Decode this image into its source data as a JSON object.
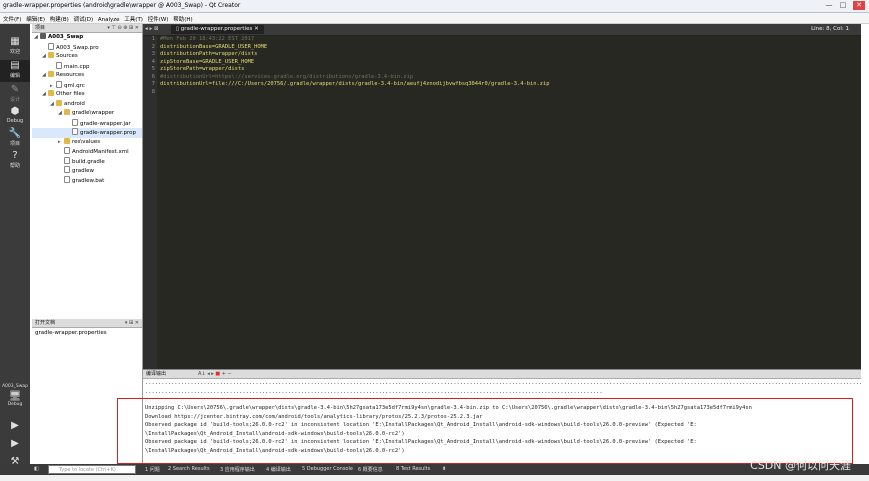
{
  "window": {
    "title": "gradle-wrapper.properties (android\\gradle\\wrapper @ A003_Swap) - Qt Creator",
    "controls": [
      "—",
      "□",
      "✕"
    ]
  },
  "menu": [
    "文件(F)",
    "编辑(E)",
    "构建(B)",
    "调试(D)",
    "Analyze",
    "工具(T)",
    "控件(W)",
    "帮助(H)"
  ],
  "modes": [
    {
      "icon": "grid-icon",
      "glyph": "▦",
      "label": "欢迎"
    },
    {
      "icon": "edit-icon",
      "glyph": "▤",
      "label": "编辑"
    },
    {
      "icon": "design-icon",
      "glyph": "✎",
      "label": "设计"
    },
    {
      "icon": "debug-icon",
      "glyph": "⬢",
      "label": "Debug"
    },
    {
      "icon": "projects-icon",
      "glyph": "🔧",
      "label": "项目"
    },
    {
      "icon": "help-icon",
      "glyph": "?",
      "label": "帮助"
    }
  ],
  "target": {
    "project": "A003_Swap",
    "mode": "Debug"
  },
  "projects_pane": {
    "title": "项目",
    "tree": [
      {
        "label": "A003_Swap",
        "icon": "project",
        "indent": 0,
        "expanded": true,
        "bold": true
      },
      {
        "label": "A003_Swap.pro",
        "icon": "file",
        "indent": 1
      },
      {
        "label": "Sources",
        "icon": "folder",
        "indent": 1,
        "expanded": true
      },
      {
        "label": "main.cpp",
        "icon": "file",
        "indent": 2
      },
      {
        "label": "Resources",
        "icon": "folder",
        "indent": 1,
        "expanded": true
      },
      {
        "label": "qml.qrc",
        "icon": "file",
        "indent": 2,
        "collapsed": true
      },
      {
        "label": "Other files",
        "icon": "folder",
        "indent": 1,
        "expanded": true
      },
      {
        "label": "android",
        "icon": "folder",
        "indent": 2,
        "expanded": true
      },
      {
        "label": "gradle\\wrapper",
        "icon": "folder",
        "indent": 3,
        "expanded": true
      },
      {
        "label": "gradle-wrapper.jar",
        "icon": "file",
        "indent": 4
      },
      {
        "label": "gradle-wrapper.prop",
        "icon": "file",
        "indent": 4,
        "selected": true
      },
      {
        "label": "res\\values",
        "icon": "folder",
        "indent": 3,
        "collapsed": true
      },
      {
        "label": "AndroidManifest.xml",
        "icon": "file",
        "indent": 3
      },
      {
        "label": "build.gradle",
        "icon": "file",
        "indent": 3
      },
      {
        "label": "gradlew",
        "icon": "file",
        "indent": 3
      },
      {
        "label": "gradlew.bat",
        "icon": "file",
        "indent": 3
      }
    ]
  },
  "open_documents": {
    "title": "打开文档",
    "items": [
      "gradle-wrapper.properties"
    ]
  },
  "editor": {
    "tab": "gradle-wrapper.properties",
    "cursor": "Line: 8, Col: 1",
    "lines": [
      {
        "n": "1",
        "text": "#Mon Feb 20 18:43:22 EST 2017",
        "comment": true
      },
      {
        "n": "2",
        "text": "distributionBase=GRADLE_USER_HOME",
        "comment": false
      },
      {
        "n": "3",
        "text": "distributionPath=wrapper/dists",
        "comment": false
      },
      {
        "n": "4",
        "text": "zipStoreBase=GRADLE_USER_HOME",
        "comment": false
      },
      {
        "n": "5",
        "text": "zipStorePath=wrapper/dists",
        "comment": false
      },
      {
        "n": "6",
        "text": "#distributionUrl=https\\://services.gradle.org/distributions/gradle-3.4-bin.zip",
        "comment": true
      },
      {
        "n": "7",
        "text": "distributionUrl=file:///C:/Users/20756/.gradle/wrapper/dists/gradle-3.4-bin/aeufj4znodijbvwfbsq3044r0/gradle-3.4-bin.zip",
        "comment": false
      },
      {
        "n": "8",
        "text": "",
        "comment": false
      }
    ]
  },
  "output": {
    "title": "编译输出",
    "lines": [
      "............................................................................................................................................................................................................................................",
      ".............................................................................................................................................",
      "Unzipping C:\\Users\\20756\\.gradle\\wrapper\\dists\\gradle-3.4-bin\\5h27gsata173e5df7rmi9y4sn\\gradle-3.4-bin.zip to C:\\Users\\20756\\.gradle\\wrapper\\dists\\gradle-3.4-bin\\5h27gsata173e5df7rmi9y4sn",
      "Download https://jcenter.bintray.com/com/android/tools/analytics-library/protos/25.2.3/protos-25.2.3.jar",
      "Observed package id 'build-tools;26.0.0-rc2' in inconsistent location 'E:\\InstallPackages\\Qt_Android_Install\\android-sdk-windows\\build-tools\\26.0.0-preview' (Expected 'E:",
      "\\InstallPackages\\Qt_Android_Install\\android-sdk-windows\\build-tools\\26.0.0-rc2')",
      "Observed package id 'build-tools;26.0.0-rc2' in inconsistent location 'E:\\InstallPackages\\Qt_Android_Install\\android-sdk-windows\\build-tools\\26.0.0-preview' (Expected 'E:",
      "\\InstallPackages\\Qt_Android_Install\\android-sdk-windows\\build-tools\\26.0.0-rc2')"
    ]
  },
  "statusbar": {
    "locator_placeholder": "Type to locate (Ctrl+K)",
    "panes": [
      "1 问题",
      "2 Search Results",
      "3 应用程序输出",
      "4 编译输出",
      "5 Debugger Console",
      "6 概要信息",
      "8 Test Results"
    ]
  },
  "watermark": "CSDN @何以问天涯",
  "colors": {
    "highlight_box": "#d61f1f",
    "editor_bg": "#272822",
    "string": "#e6db74",
    "comment": "#75715e"
  }
}
